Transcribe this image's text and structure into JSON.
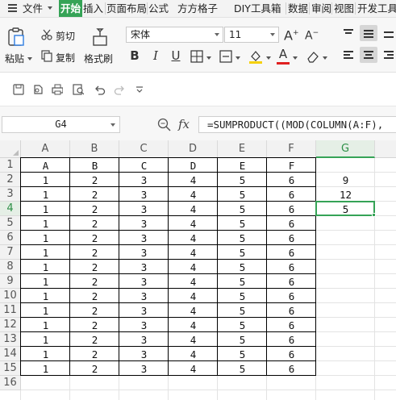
{
  "menu": {
    "file": "文件",
    "items": [
      "开始",
      "插入",
      "页面布局",
      "公式",
      "方方格子",
      "DIY工具箱",
      "数据",
      "审阅",
      "视图",
      "开发工具"
    ]
  },
  "ribbon": {
    "paste": "粘贴",
    "cut": "剪切",
    "copy": "复制",
    "format_painter": "格式刷",
    "font_name": "宋体",
    "font_size": "11"
  },
  "formula_bar": {
    "cell_ref": "G4",
    "fx": "fx",
    "formula": "=SUMPRODUCT((MOD(COLUMN(A:F),"
  },
  "sheet": {
    "columns": [
      "A",
      "B",
      "C",
      "D",
      "E",
      "F",
      "G"
    ],
    "rows": [
      "1",
      "2",
      "3",
      "4",
      "5",
      "6",
      "7",
      "8",
      "9",
      "10",
      "11",
      "12",
      "13",
      "14",
      "15",
      "16"
    ],
    "header_row": [
      "A",
      "B",
      "C",
      "D",
      "E",
      "F"
    ],
    "data_row": [
      "1",
      "2",
      "3",
      "4",
      "5",
      "6"
    ],
    "g_values": {
      "row2": "9",
      "row3": "12",
      "row4": "5"
    },
    "selected_cell": "G4"
  },
  "colors": {
    "accent": "#35a356"
  }
}
